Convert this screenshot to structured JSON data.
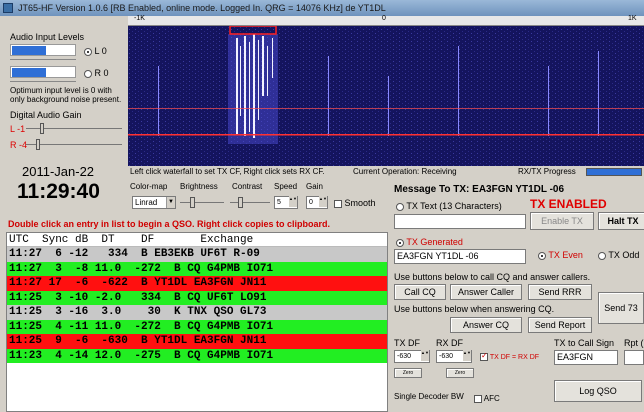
{
  "window": {
    "title": "JT65-HF Version 1.0.6  [RB Enabled, online mode. Logged In. QRG = 14076 KHz] de YT1DL"
  },
  "ruler": {
    "left_tick": "-1K",
    "center_tick": "0",
    "right_tick": "1K"
  },
  "audio": {
    "input_label": "Audio Input Levels",
    "left_channel": "L 0",
    "right_channel": "R 0",
    "optimum_note": "Optimum input level is 0 with only background noise present.",
    "digital_gain_label": "Digital Audio Gain",
    "gain_left_label": "L -1",
    "gain_right_label": "R -4"
  },
  "clock": {
    "date": "2011-Jan-22",
    "time": "11:29:40"
  },
  "status": {
    "waterfall_hint": "Left click waterfall to set TX CF, Right click sets RX CF.",
    "operation": "Current Operation: Receiving",
    "progress_label": "RX/TX Progress"
  },
  "controls": {
    "colormap_label": "Color-map",
    "colormap_value": "Linrad",
    "brightness_label": "Brightness",
    "contrast_label": "Contrast",
    "speed_label": "Speed",
    "speed_value": "5",
    "gain_label": "Gain",
    "gain_value": "0",
    "smooth_label": "Smooth"
  },
  "decode_hint": "Double click an entry in list to begin a QSO.  Right click copies to clipboard.",
  "decode": {
    "header": "UTC  Sync dB  DT    DF       Exchange",
    "rows": [
      {
        "text": "11:27  6 -12   334  B EB3EKB UF6T R-09",
        "bg": "#c8c8c8"
      },
      {
        "text": "11:27  3  -8 11.0  -272  B CQ G4PMB IO71",
        "bg": "#22ee22"
      },
      {
        "text": "11:27 17  -6  -622  B YT1DL EA3FGN JN11",
        "bg": "#ff1010"
      },
      {
        "text": "11:25  3 -10 -2.0   334  B CQ UF6T LO91",
        "bg": "#22ee22"
      },
      {
        "text": "11:25  3 -16  3.0    30  K TNX QSO GL73",
        "bg": "#c8c8c8"
      },
      {
        "text": "11:25  4 -11 11.0  -272  B CQ G4PMB IO71",
        "bg": "#22ee22"
      },
      {
        "text": "11:25  9  -6  -630  B YT1DL EA3FGN JN11",
        "bg": "#ff1010"
      },
      {
        "text": "11:23  4 -14 12.0  -275  B CQ G4PMB IO71",
        "bg": "#22ee22"
      }
    ]
  },
  "tx": {
    "message_to": "Message To TX: EA3FGN YT1DL -06",
    "tx_text_label": "TX Text (13 Characters)",
    "tx_enabled": "TX ENABLED",
    "enable_tx": "Enable TX",
    "halt_tx": "Halt TX",
    "tx_generated_label": "TX Generated",
    "generated_value": "EA3FGN YT1DL -06",
    "tx_even": "TX Even",
    "tx_odd": "TX Odd",
    "cq_hint": "Use buttons below to call CQ and answer callers.",
    "call_cq": "Call CQ",
    "answer_caller": "Answer Caller",
    "send_rrr": "Send RRR",
    "send_73": "Send 73",
    "answer_hint": "Use buttons below when answering CQ.",
    "answer_cq": "Answer CQ",
    "send_report": "Send Report",
    "tx_df_label": "TX DF",
    "tx_df_value": "-630",
    "rx_df_label": "RX DF",
    "rx_df_value": "-630",
    "zero_label": "Zero",
    "txdf_rxdf": "TX DF = RX DF",
    "call_sign_label": "TX to Call Sign",
    "call_sign_value": "EA3FGN",
    "rpt_label": "Rpt (",
    "log_qso": "Log QSO",
    "single_decoder": "Single Decoder BW",
    "afc": "AFC"
  },
  "colors": {
    "waterfall_bg": "#12125a",
    "tx_enabled": "#e00000",
    "hint_red": "#d00000",
    "progress": "#2f6fd6"
  }
}
